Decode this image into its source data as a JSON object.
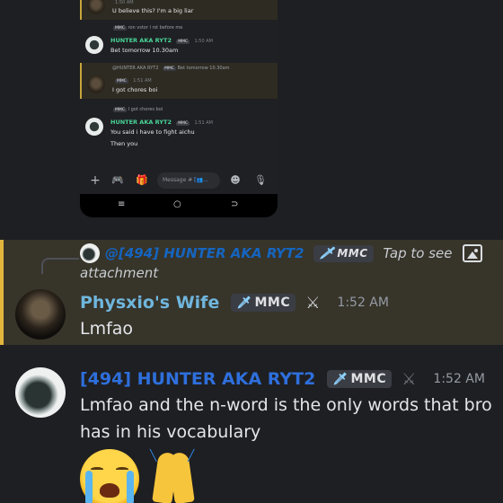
{
  "phone": {
    "messages": [
      {
        "name": "",
        "time": "1:50 AM",
        "text": "U believe this? I'm a big liar",
        "highlight": true
      },
      {
        "reply_user": "",
        "reply_badge": "MMC",
        "reply_text": "ron vstor l rst before me",
        "name": "HUNTER AKA RYT2",
        "badge": "MMC",
        "time": "1:50 AM",
        "text": "Bet tomorrow 10.30am",
        "highlight": false
      },
      {
        "reply_user": "@HUNTER AKA RYT2",
        "reply_badge": "MMC",
        "reply_text": "Bet tomorrow 10.30am",
        "name": "",
        "badge": "MMC",
        "time": "1:51 AM",
        "text": "I got chores boi",
        "highlight": true
      },
      {
        "reply_user": "",
        "reply_badge": "MMC",
        "reply_text": "I got chores boi",
        "name": "HUNTER AKA RYT2",
        "badge": "MMC",
        "time": "1:51 AM",
        "text": "You said i have to fight aichu",
        "text2": "Then you",
        "highlight": false
      }
    ],
    "input_placeholder": "Message #",
    "input_suffix": "[👥...",
    "icons": [
      "plus-icon",
      "gamepad-icon",
      "gift-icon",
      "emoji-icon",
      "mic-icon"
    ],
    "nav": [
      "recents-icon",
      "home-icon",
      "back-icon"
    ]
  },
  "chat": {
    "reply": {
      "user": "@[494] HUNTER AKA RYT2",
      "badge": "MMC",
      "text": "Tap to see",
      "attachment": "attachment"
    },
    "messages": [
      {
        "username": "Physxio's Wife",
        "badge": "MMC",
        "timestamp": "1:52 AM",
        "text": "Lmfao",
        "highlighted": true,
        "name_color": "#6fb6dd"
      },
      {
        "username": "[494] HUNTER AKA RYT2",
        "badge": "MMC",
        "timestamp": "1:52 AM",
        "text_line1": "Lmfao and the n-word is the only words that bro",
        "text_line2": "has in his vocabulary",
        "highlighted": false,
        "name_color": "#2e6fdc",
        "emojis": [
          "loudly-crying-face-emoji",
          "folded-hands-emoji"
        ]
      }
    ]
  },
  "colors": {
    "background": "#1e1f22",
    "mention_highlight": "#37342a",
    "mention_bar": "#e2b53d"
  }
}
